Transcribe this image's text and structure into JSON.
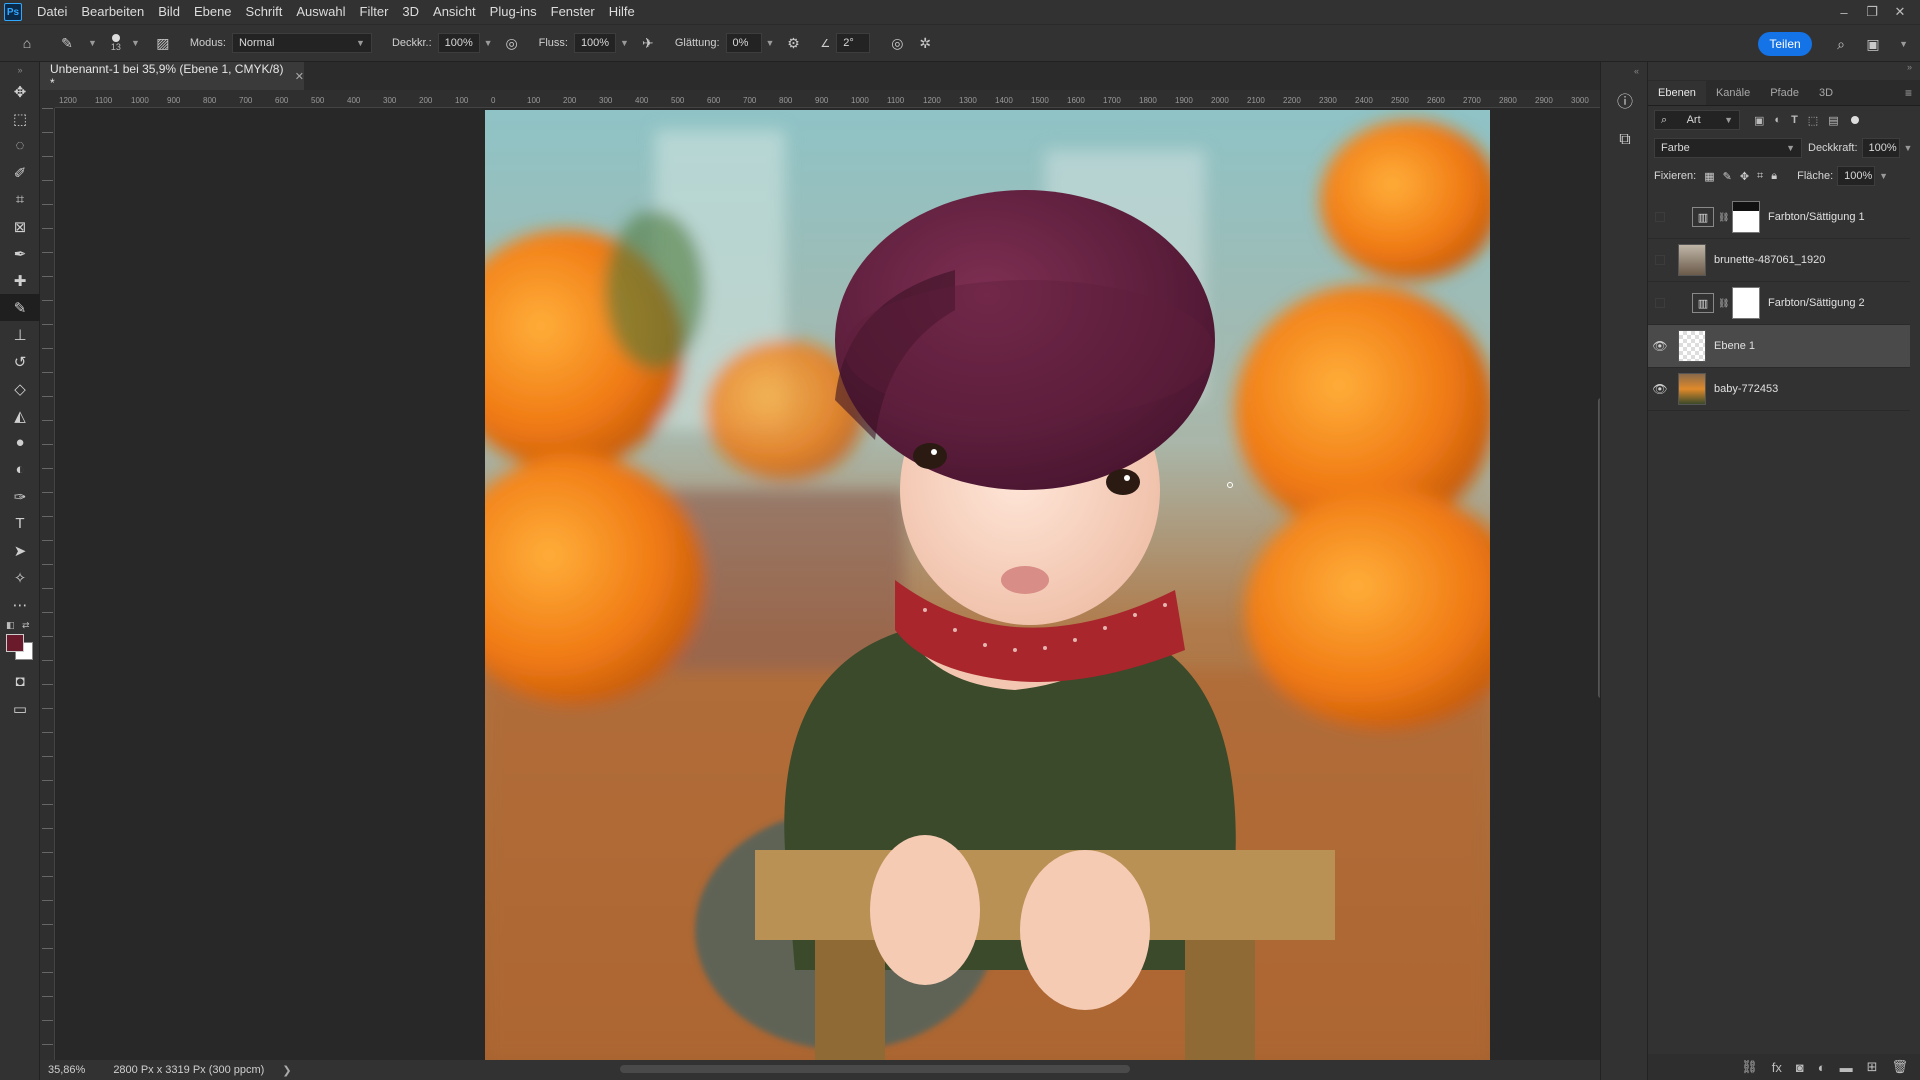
{
  "menu": {
    "logo": "Ps",
    "items": [
      "Datei",
      "Bearbeiten",
      "Bild",
      "Ebene",
      "Schrift",
      "Auswahl",
      "Filter",
      "3D",
      "Ansicht",
      "Plug-ins",
      "Fenster",
      "Hilfe"
    ]
  },
  "options": {
    "brush_size": "13",
    "mode_label": "Modus:",
    "mode_value": "Normal",
    "opacity_label": "Deckkr.:",
    "opacity_value": "100%",
    "flow_label": "Fluss:",
    "flow_value": "100%",
    "smoothing_label": "Glättung:",
    "smoothing_value": "0%",
    "angle_value": "2°",
    "share_label": "Teilen"
  },
  "document": {
    "tab_title": "Unbenannt-1 bei 35,9% (Ebene 1, CMYK/8) *",
    "zoom": "35,86%",
    "dimensions": "2800 Px x 3319 Px (300 ppcm)"
  },
  "ruler": {
    "h_labels": [
      "1200",
      "1100",
      "1000",
      "900",
      "800",
      "700",
      "600",
      "500",
      "400",
      "300",
      "200",
      "100",
      "0",
      "100",
      "200",
      "300",
      "400",
      "500",
      "600",
      "700",
      "800",
      "900",
      "1000",
      "1100",
      "1200",
      "1300",
      "1400",
      "1500",
      "1600",
      "1700",
      "1800",
      "1900",
      "2000",
      "2100",
      "2200",
      "2300",
      "2400",
      "2500",
      "2600",
      "2700",
      "2800",
      "2900",
      "3000"
    ]
  },
  "layers_panel": {
    "tabs": [
      "Ebenen",
      "Kanäle",
      "Pfade",
      "3D"
    ],
    "filter_kind": "Art",
    "blend_mode": "Farbe",
    "opacity_label": "Deckkraft:",
    "opacity_value": "100%",
    "lock_label": "Fixieren:",
    "fill_label": "Fläche:",
    "fill_value": "100%",
    "layers": [
      {
        "name": "Farbton/Sättigung 1",
        "visible": false,
        "type": "adjustment"
      },
      {
        "name": "brunette-487061_1920",
        "visible": false,
        "type": "image"
      },
      {
        "name": "Farbton/Sättigung 2",
        "visible": false,
        "type": "adjustment"
      },
      {
        "name": "Ebene 1",
        "visible": true,
        "type": "image",
        "selected": true
      },
      {
        "name": "baby-772453",
        "visible": true,
        "type": "image"
      }
    ]
  },
  "colors": {
    "accent": "#1473e6",
    "foreground": "#6a1a2a",
    "background": "#ffffff"
  }
}
